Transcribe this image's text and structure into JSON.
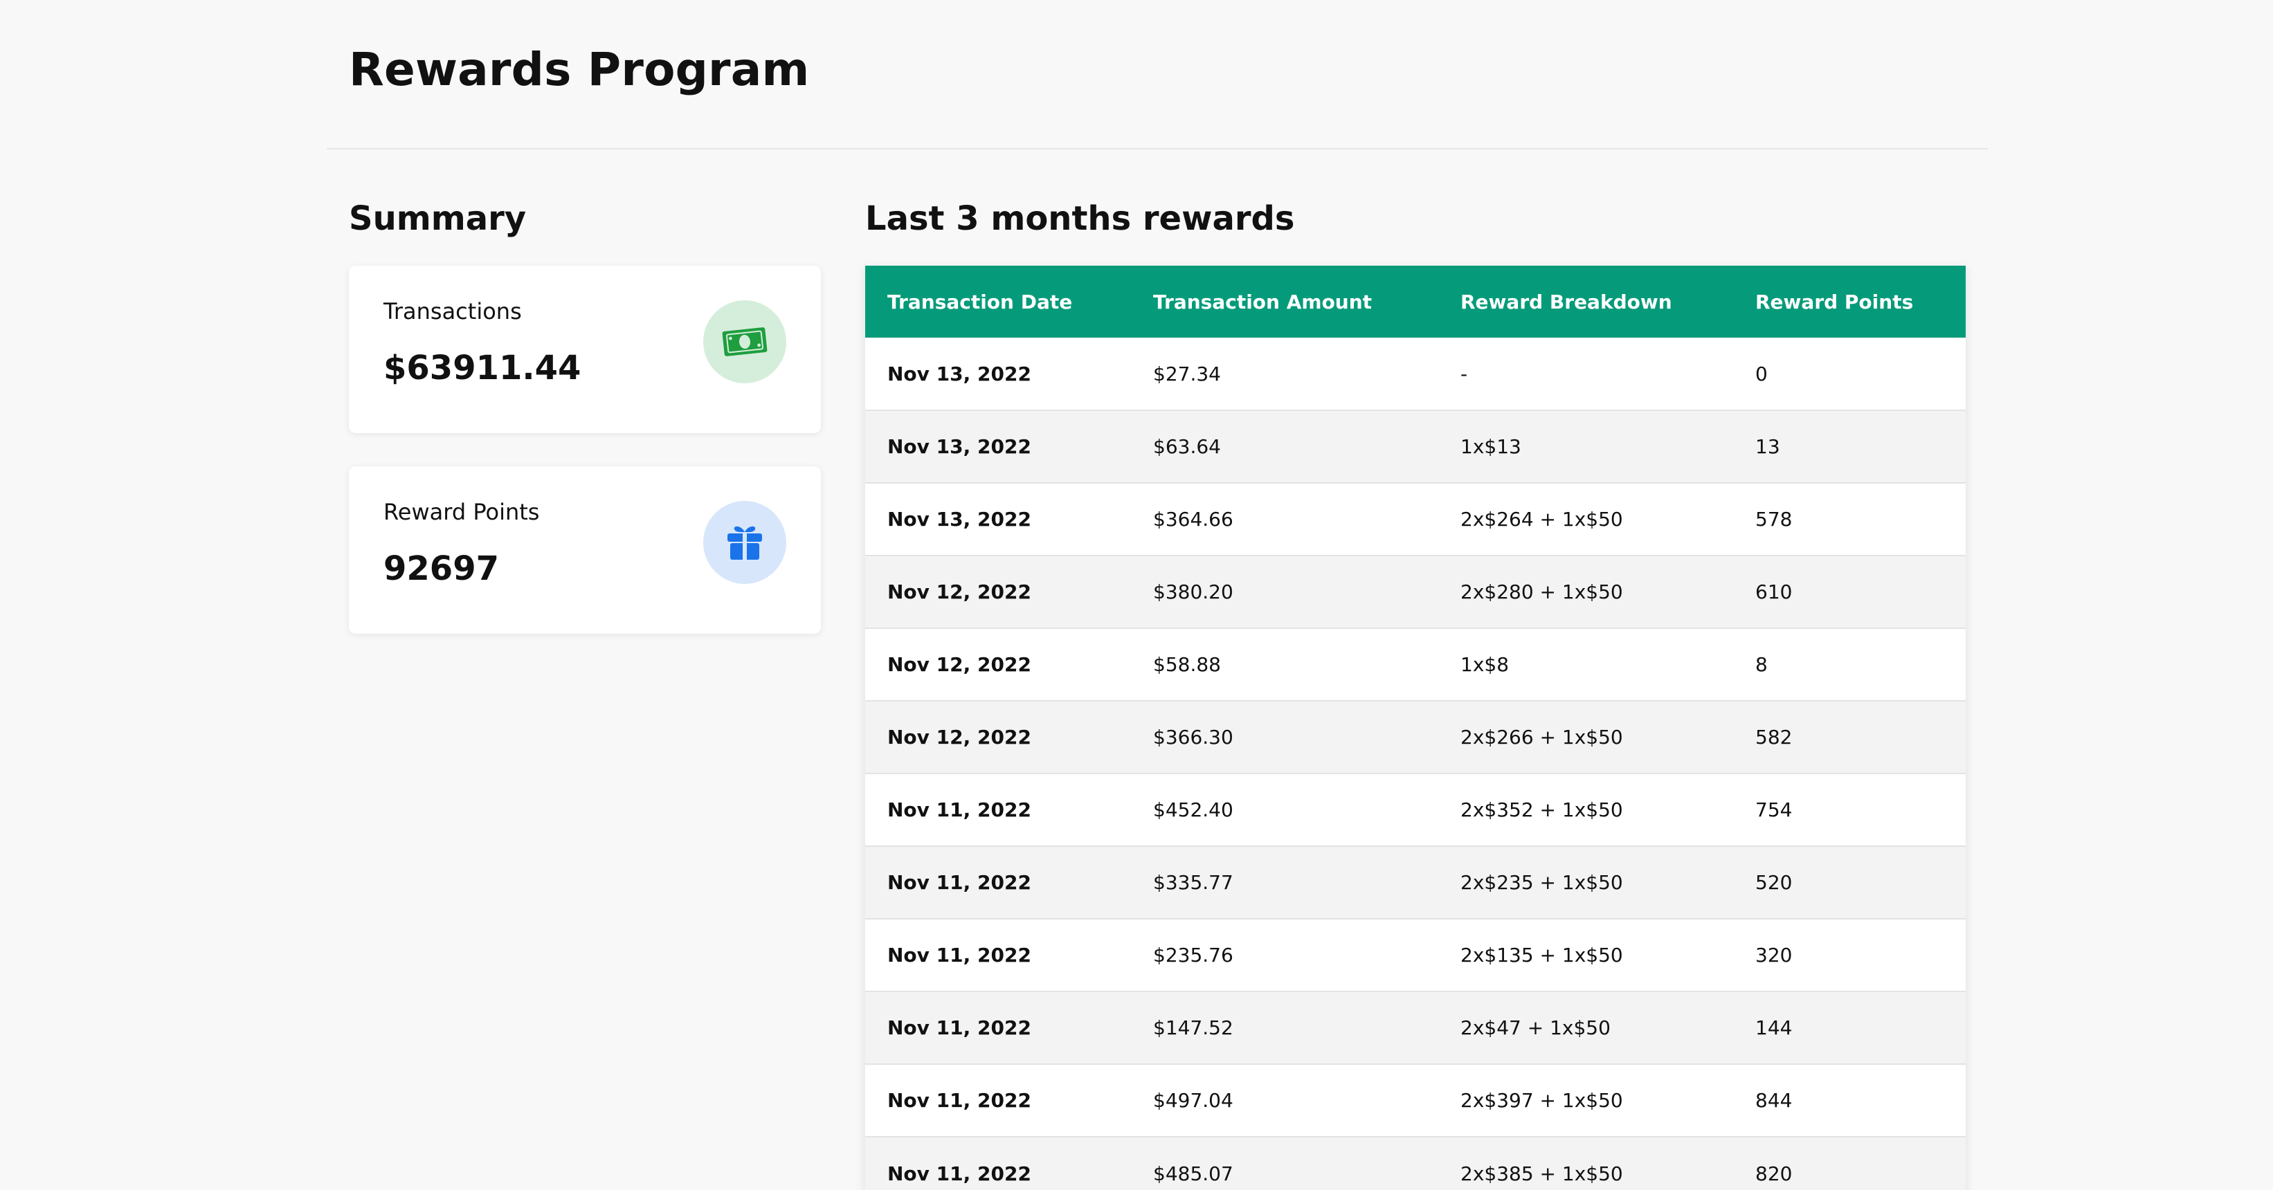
{
  "page": {
    "title": "Rewards Program"
  },
  "summary": {
    "title": "Summary",
    "cards": [
      {
        "label": "Transactions",
        "value": "$63911.44",
        "icon": "money-icon",
        "icon_color": "#1e9e3e",
        "icon_bg": "#d5eedb"
      },
      {
        "label": "Reward Points",
        "value": "92697",
        "icon": "gift-icon",
        "icon_color": "#1a73e8",
        "icon_bg": "#d7e6fb"
      }
    ]
  },
  "rewards": {
    "title": "Last 3 months rewards",
    "header_color": "#059b7a",
    "columns": [
      "Transaction Date",
      "Transaction Amount",
      "Reward Breakdown",
      "Reward Points"
    ],
    "rows": [
      [
        "Nov 13, 2022",
        "$27.34",
        "-",
        "0"
      ],
      [
        "Nov 13, 2022",
        "$63.64",
        "1x$13",
        "13"
      ],
      [
        "Nov 13, 2022",
        "$364.66",
        "2x$264 + 1x$50",
        "578"
      ],
      [
        "Nov 12, 2022",
        "$380.20",
        "2x$280 + 1x$50",
        "610"
      ],
      [
        "Nov 12, 2022",
        "$58.88",
        "1x$8",
        "8"
      ],
      [
        "Nov 12, 2022",
        "$366.30",
        "2x$266 + 1x$50",
        "582"
      ],
      [
        "Nov 11, 2022",
        "$452.40",
        "2x$352 + 1x$50",
        "754"
      ],
      [
        "Nov 11, 2022",
        "$335.77",
        "2x$235 + 1x$50",
        "520"
      ],
      [
        "Nov 11, 2022",
        "$235.76",
        "2x$135 + 1x$50",
        "320"
      ],
      [
        "Nov 11, 2022",
        "$147.52",
        "2x$47 + 1x$50",
        "144"
      ],
      [
        "Nov 11, 2022",
        "$497.04",
        "2x$397 + 1x$50",
        "844"
      ],
      [
        "Nov 11, 2022",
        "$485.07",
        "2x$385 + 1x$50",
        "820"
      ]
    ]
  }
}
